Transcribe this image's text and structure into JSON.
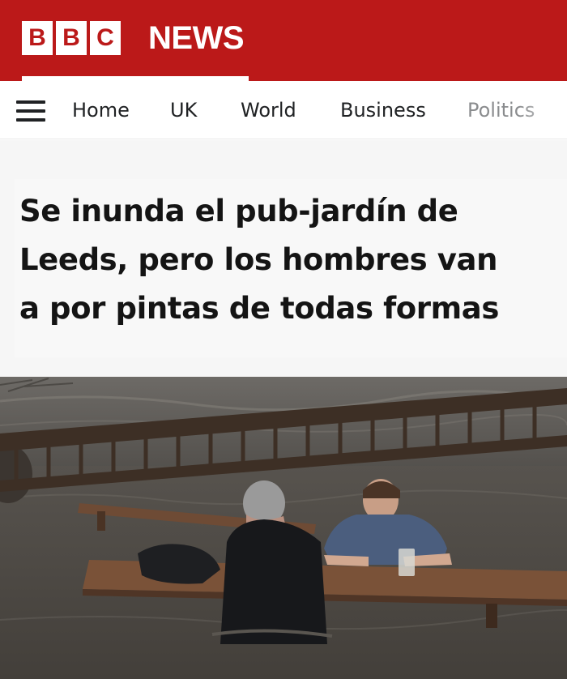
{
  "brand": {
    "letters": [
      "B",
      "B",
      "C"
    ],
    "word": "NEWS",
    "color": "#bb1919"
  },
  "nav": {
    "menu_icon": "hamburger-menu-icon",
    "items": [
      "Home",
      "UK",
      "World",
      "Business",
      "Politics"
    ]
  },
  "article": {
    "headline": "Se inunda el pub-jardín de Leeds, pero los hombres van a por pintas de todas formas",
    "headline_lines": [
      "Se inunda el pub-jardín de",
      "Leeds, pero los hombres van",
      "a por pintas de todas formas"
    ]
  }
}
